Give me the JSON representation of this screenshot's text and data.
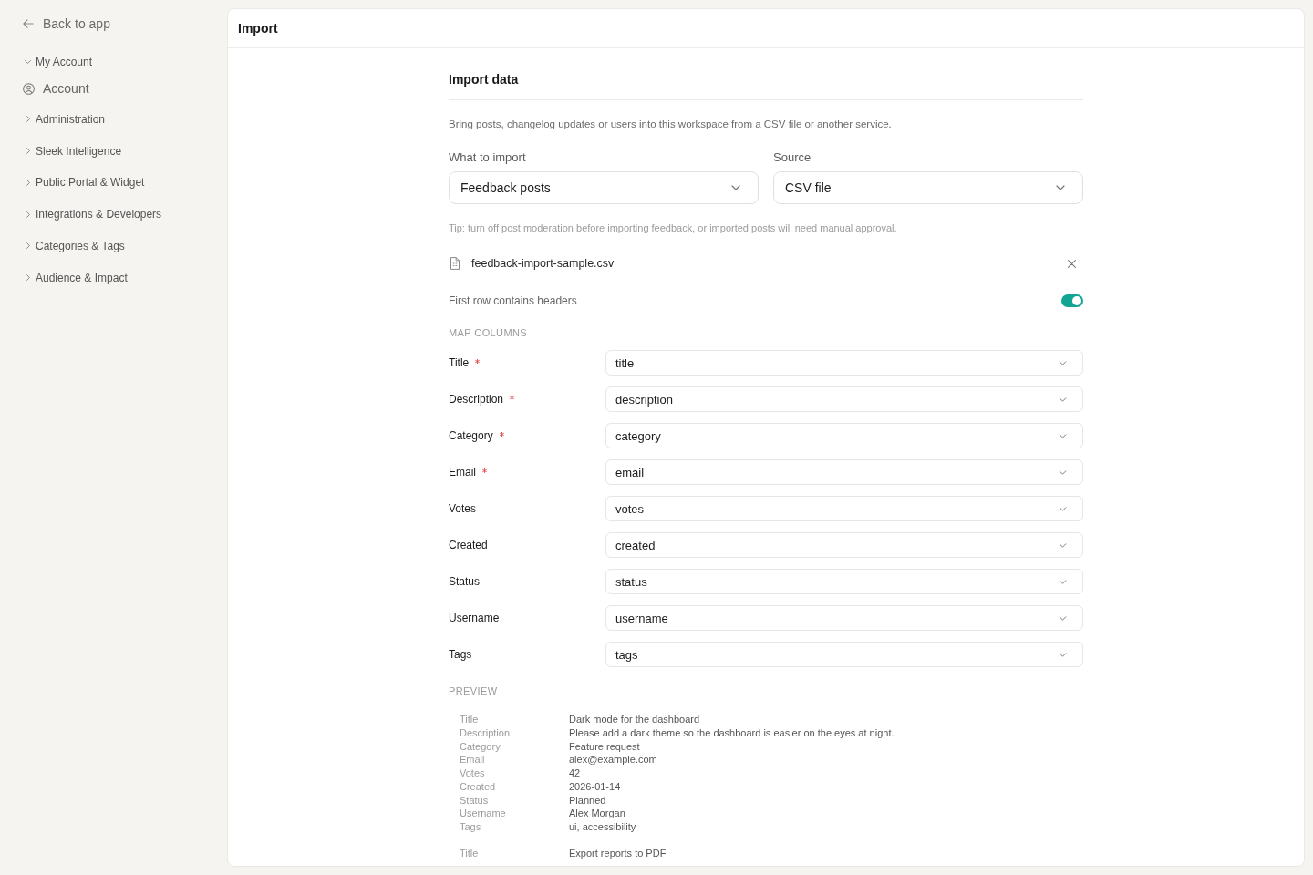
{
  "sidebar": {
    "back_link": "Back to app",
    "groups": [
      {
        "label": "My Account",
        "expanded": true,
        "children": [
          {
            "label": "Account"
          }
        ]
      },
      {
        "label": "Administration",
        "expanded": false
      },
      {
        "label": "Sleek Intelligence",
        "expanded": false
      },
      {
        "label": "Public Portal & Widget",
        "expanded": false
      },
      {
        "label": "Integrations & Developers",
        "expanded": false
      },
      {
        "label": "Categories & Tags",
        "expanded": false
      },
      {
        "label": "Audience & Impact",
        "expanded": false
      }
    ]
  },
  "panel": {
    "title": "Import"
  },
  "section": {
    "title": "Import data",
    "description": "Bring posts, changelog updates or users into this workspace from a CSV file or another service.",
    "what_to_import": {
      "label": "What to import",
      "value": "Feedback posts"
    },
    "source": {
      "label": "Source",
      "value": "CSV file"
    },
    "tip": "Tip: turn off post moderation before importing feedback, or imported posts will need manual approval.",
    "file": {
      "name": "feedback-import-sample.csv"
    },
    "headers_toggle": {
      "label": "First row contains headers",
      "on": true
    }
  },
  "mapping": {
    "heading": "MAP COLUMNS",
    "rows": [
      {
        "field": "Title",
        "required": true,
        "value": "title"
      },
      {
        "field": "Description",
        "required": true,
        "value": "description"
      },
      {
        "field": "Category",
        "required": true,
        "value": "category"
      },
      {
        "field": "Email",
        "required": true,
        "value": "email"
      },
      {
        "field": "Votes",
        "required": false,
        "value": "votes"
      },
      {
        "field": "Created",
        "required": false,
        "value": "created"
      },
      {
        "field": "Status",
        "required": false,
        "value": "status"
      },
      {
        "field": "Username",
        "required": false,
        "value": "username"
      },
      {
        "field": "Tags",
        "required": false,
        "value": "tags"
      }
    ]
  },
  "preview": {
    "heading": "PREVIEW",
    "records": [
      {
        "fields": [
          {
            "label": "Title",
            "value": "Dark mode for the dashboard"
          },
          {
            "label": "Description",
            "value": "Please add a dark theme so the dashboard is easier on the eyes at night."
          },
          {
            "label": "Category",
            "value": "Feature request"
          },
          {
            "label": "Email",
            "value": "alex@example.com"
          },
          {
            "label": "Votes",
            "value": "42"
          },
          {
            "label": "Created",
            "value": "2026-01-14"
          },
          {
            "label": "Status",
            "value": "Planned"
          },
          {
            "label": "Username",
            "value": "Alex Morgan"
          },
          {
            "label": "Tags",
            "value": "ui, accessibility"
          }
        ]
      },
      {
        "fields": [
          {
            "label": "Title",
            "value": "Export reports to PDF"
          }
        ]
      }
    ]
  }
}
